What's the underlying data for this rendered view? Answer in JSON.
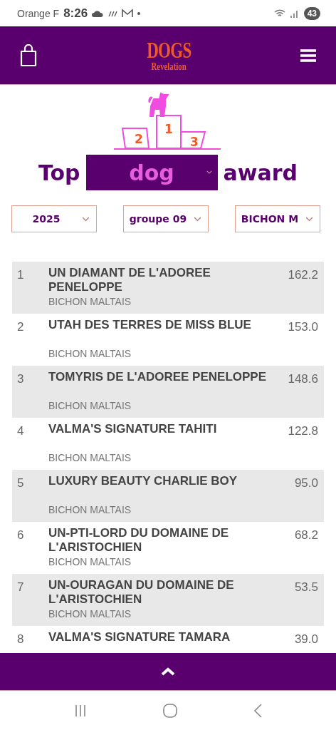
{
  "status_bar": {
    "carrier": "Orange F",
    "time": "8:26",
    "battery": "43"
  },
  "header": {
    "logo_top": "DOGS",
    "logo_bottom": "Revelation"
  },
  "podium": {
    "places": [
      "2",
      "1",
      "3"
    ]
  },
  "title": {
    "before": "Top",
    "select_value": "dog",
    "after": "award"
  },
  "filters": [
    {
      "value": "2025"
    },
    {
      "value": "groupe 09"
    },
    {
      "value": "BICHON M"
    }
  ],
  "rankings": [
    {
      "rank": "1",
      "name": "UN DIAMANT DE L'ADOREE PENELOPPE",
      "breed": "BICHON MALTAIS",
      "score": "162.2"
    },
    {
      "rank": "2",
      "name": "UTAH DES TERRES DE MISS BLUE",
      "breed": "BICHON MALTAIS",
      "score": "153.0"
    },
    {
      "rank": "3",
      "name": "TOMYRIS DE L'ADOREE PENELOPPE",
      "breed": "BICHON MALTAIS",
      "score": "148.6"
    },
    {
      "rank": "4",
      "name": "VALMA'S SIGNATURE TAHITI",
      "breed": "BICHON MALTAIS",
      "score": "122.8"
    },
    {
      "rank": "5",
      "name": "LUXURY BEAUTY CHARLIE BOY",
      "breed": "BICHON MALTAIS",
      "score": "95.0"
    },
    {
      "rank": "6",
      "name": "UN-PTI-LORD DU DOMAINE DE L'ARISTOCHIEN",
      "breed": "BICHON MALTAIS",
      "score": "68.2"
    },
    {
      "rank": "7",
      "name": "UN-OURAGAN DU DOMAINE DE L'ARISTOCHIEN",
      "breed": "BICHON MALTAIS",
      "score": "53.5"
    },
    {
      "rank": "8",
      "name": "VALMA'S SIGNATURE TAMARA",
      "score": "39.0"
    }
  ]
}
